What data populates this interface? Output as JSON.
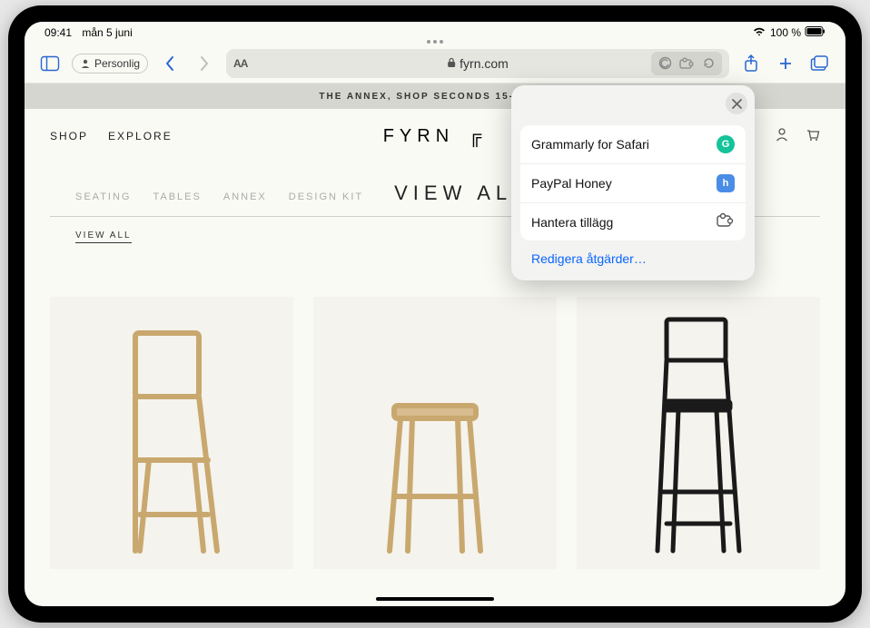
{
  "status": {
    "time": "09:41",
    "date": "mån 5 juni",
    "battery_text": "100 %"
  },
  "toolbar": {
    "profile_label": "Personlig",
    "url_display": "fyrn.com",
    "text_size_label": "AA"
  },
  "page": {
    "promo": "THE ANNEX, SHOP SECONDS 15-50% O",
    "nav": {
      "shop": "SHOP",
      "explore": "EXPLORE"
    },
    "logo_text": "FYRN",
    "filters": {
      "seating": "SEATING",
      "tables": "TABLES",
      "annex": "ANNEX",
      "design_kit": "DESIGN KIT",
      "view_all_title": "VIEW ALL",
      "view_all_sub": "VIEW ALL"
    }
  },
  "popover": {
    "items": [
      {
        "label": "Grammarly for Safari",
        "icon": "grammarly"
      },
      {
        "label": "PayPal Honey",
        "icon": "honey"
      },
      {
        "label": "Hantera tillägg",
        "icon": "puzzle"
      }
    ],
    "edit_link": "Redigera åtgärder…"
  }
}
